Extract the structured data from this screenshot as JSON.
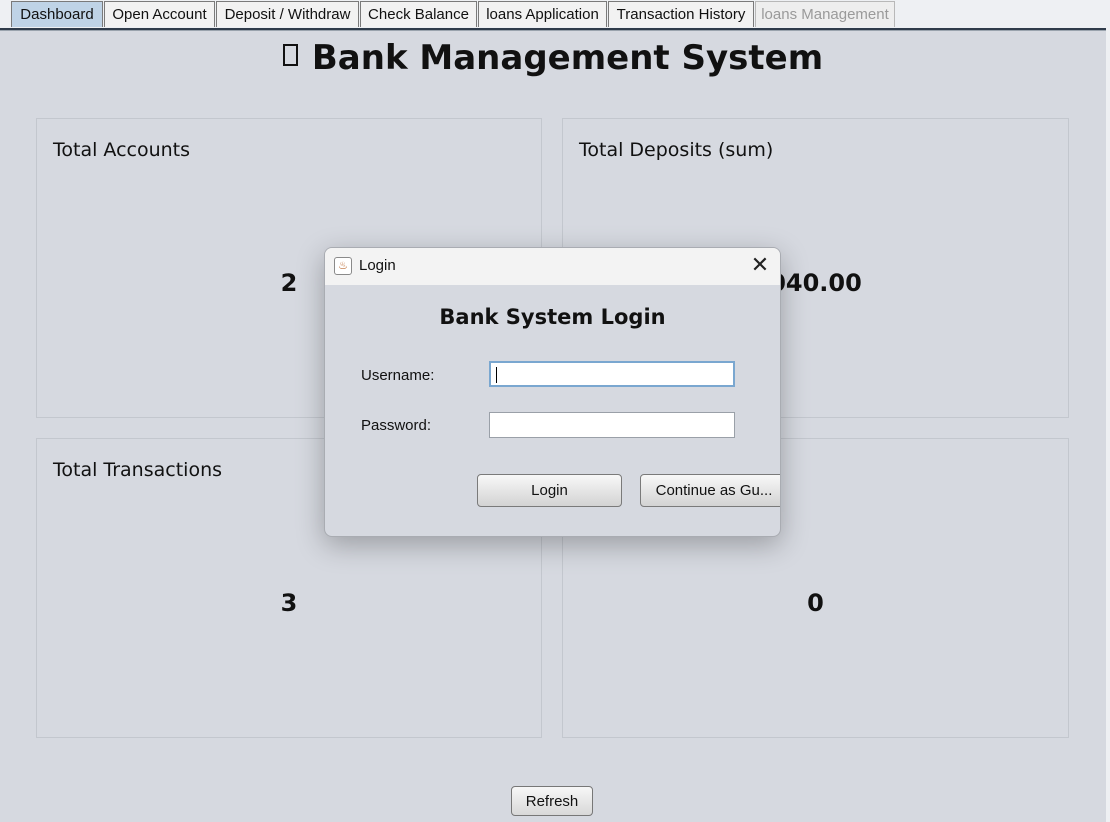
{
  "tabs": [
    {
      "label": "Dashboard",
      "state": "selected"
    },
    {
      "label": "Open Account",
      "state": "normal"
    },
    {
      "label": "Deposit / Withdraw",
      "state": "normal"
    },
    {
      "label": "Check Balance",
      "state": "normal"
    },
    {
      "label": "loans Application",
      "state": "normal"
    },
    {
      "label": "Transaction History",
      "state": "normal"
    },
    {
      "label": "loans Management",
      "state": "disabled"
    }
  ],
  "dashboard": {
    "title": "Bank Management System",
    "cards": [
      {
        "label": "Total Accounts",
        "value": "2"
      },
      {
        "label": "Total Deposits (sum)",
        "value": "040.00"
      },
      {
        "label": "Total Transactions",
        "value": "3"
      },
      {
        "label": "",
        "value": "0"
      }
    ],
    "refresh_label": "Refresh"
  },
  "dialog": {
    "title": "Login",
    "close_glyph": "✕",
    "heading": "Bank System Login",
    "username_label": "Username:",
    "username_value": "",
    "password_label": "Password:",
    "password_value": "",
    "login_label": "Login",
    "guest_label": "Continue as Gu..."
  },
  "colors": {
    "background": "#d6d9e0",
    "selected_tab": "#bfd3e6"
  }
}
